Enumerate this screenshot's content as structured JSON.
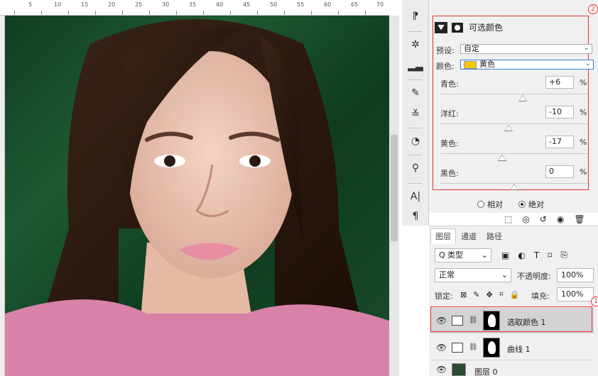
{
  "ruler": {
    "numbers": [
      "5",
      "10",
      "15",
      "20",
      "25",
      "30",
      "35",
      "40",
      "45",
      "50",
      "55",
      "60",
      "65",
      "70"
    ]
  },
  "photo": {
    "alt": "portrait"
  },
  "properties": {
    "title": "可选颜色",
    "preset_label": "预设:",
    "preset_value": "自定",
    "color_label": "颜色:",
    "color_value": "黄色",
    "sliders": [
      {
        "label": "青色:",
        "value": "+6",
        "unit": "%",
        "position": 0.56
      },
      {
        "label": "洋红:",
        "value": "-10",
        "unit": "%",
        "position": 0.46
      },
      {
        "label": "黄色:",
        "value": "-17",
        "unit": "%",
        "position": 0.42
      },
      {
        "label": "黑色:",
        "value": "0",
        "unit": "%",
        "position": 0.5
      }
    ],
    "method_relative": "相对",
    "method_absolute": "绝对",
    "badge_top": "2"
  },
  "layers": {
    "tabs": [
      "图层",
      "通道",
      "路径"
    ],
    "filter_label": "Q 类型",
    "blend_mode": "正常",
    "opacity_label": "不透明度:",
    "opacity_value": "100%",
    "lock_label": "锁定:",
    "fill_label": "填充:",
    "fill_value": "100%",
    "items": [
      {
        "name": "选取颜色 1"
      },
      {
        "name": "曲线 1"
      },
      {
        "name": "图层 0"
      }
    ],
    "badge_layer": "1"
  },
  "colors": {
    "highlight": "#e03030",
    "swatch": "#f2c800"
  }
}
